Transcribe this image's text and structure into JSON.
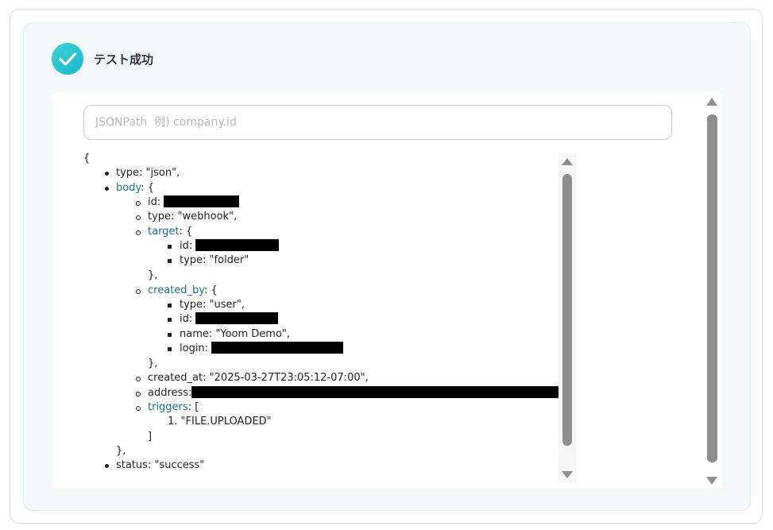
{
  "status": {
    "title": "テスト成功",
    "icon": "check-icon",
    "accent_color": "#1bb6cf"
  },
  "search": {
    "placeholder": "JSONPath  例) company.id",
    "value": ""
  },
  "tree": {
    "open_brace": "{",
    "type_line": "type: \"json\",",
    "body_key": "body",
    "body_open": ": {",
    "id_label": "id:",
    "type_webhook": "type: \"webhook\",",
    "target_key": "target",
    "target_open": ": {",
    "target_id_label": "id:",
    "target_type": "type: \"folder\"",
    "target_close": "},",
    "created_by_key": "created_by",
    "created_by_open": ": {",
    "cb_type": "type: \"user\",",
    "cb_id_label": "id:",
    "cb_name": "name: \"Yoom Demo\",",
    "cb_login_label": "login:",
    "created_by_close": "},",
    "created_at": "created_at: \"2025-03-27T23:05:12-07:00\",",
    "address_label": "address:",
    "triggers_key": "triggers",
    "triggers_open": ": [",
    "trigger_item": "1. \"FILE.UPLOADED\"",
    "triggers_close": "]",
    "body_close": "},",
    "status_line": "status: \"success\""
  }
}
